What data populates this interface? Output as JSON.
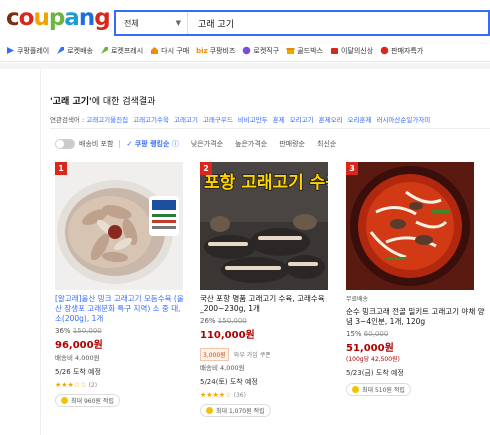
{
  "header": {
    "logo": [
      "c",
      "o",
      "u",
      "p",
      "a",
      "n",
      "g"
    ],
    "search_category": "전체",
    "search_query": "고래 고기"
  },
  "menu": [
    {
      "label": "쿠팡플레이",
      "color": "#346aff"
    },
    {
      "label": "로켓배송",
      "color": "#346aff"
    },
    {
      "label": "로켓프레시",
      "color": "#6cb43f"
    },
    {
      "label": "다시 구매",
      "color": "#f28c00"
    },
    {
      "label": "쿠팡비즈",
      "color": "#f28c00"
    },
    {
      "label": "로켓직구",
      "color": "#7a4dd8"
    },
    {
      "label": "골드박스",
      "color": "#f4a300"
    },
    {
      "label": "이달의신상",
      "color": "#d9271c"
    },
    {
      "label": "판매자특가",
      "color": "#d9271c"
    }
  ],
  "results": {
    "title_quoted": "'고래 고기'",
    "title_rest": "에 대한 검색결과",
    "related_label": "연관검색어 :",
    "related": [
      "고래고기울진집",
      "고래고기수육",
      "고래고기",
      "고래구우드",
      "비비고만두",
      "훈제",
      "오리고기",
      "훈제오리",
      "오리훈제",
      "러시아산순일가자미"
    ]
  },
  "filters": {
    "rocket_toggle": "배송비 포함",
    "sort_active": "쿠팡 랭킹순",
    "options": [
      "낮은가격순",
      "높은가격순",
      "판매량순",
      "최신순"
    ]
  },
  "products": [
    {
      "rank": "1",
      "title": "[알고래]울산 밍크 고래고기 모듬수육 (울산 장생포 고래문화 특구 지역) 소 중 대, 소(200g), 1개",
      "discount": "36%",
      "original": "150,000",
      "price": "96,000원",
      "shipping": "배송비 4,000원",
      "arrival": "5/26 도착 예정",
      "rating_count": "(2)",
      "reward": "최대 960원 적립"
    },
    {
      "rank": "2",
      "image_text": "포항 고래고기 수육",
      "title": "국산 포항 명품 고래고기 수육, 고래수육_200~230g, 1개",
      "discount": "26%",
      "original": "150,000",
      "price": "110,000원",
      "coupon": "3,000원",
      "coupon_note": "와우 가입 쿠폰",
      "shipping": "배송비 4,000원",
      "arrival": "5/24(토) 도착 예정",
      "rating_count": "(36)",
      "reward": "최대 1,070원 적립"
    },
    {
      "rank": "3",
      "delivery_tag": "무료배송",
      "title": "순수 밍크고래 전골 밀키트 고래고기 야채 양념 3~4인분, 1개, 120g",
      "discount": "15%",
      "original": "60,000",
      "price": "51,000원",
      "unit_price": "(100g당 42,500원)",
      "arrival": "5/23(금) 도착 예정",
      "reward": "최대 510원 적립"
    }
  ]
}
